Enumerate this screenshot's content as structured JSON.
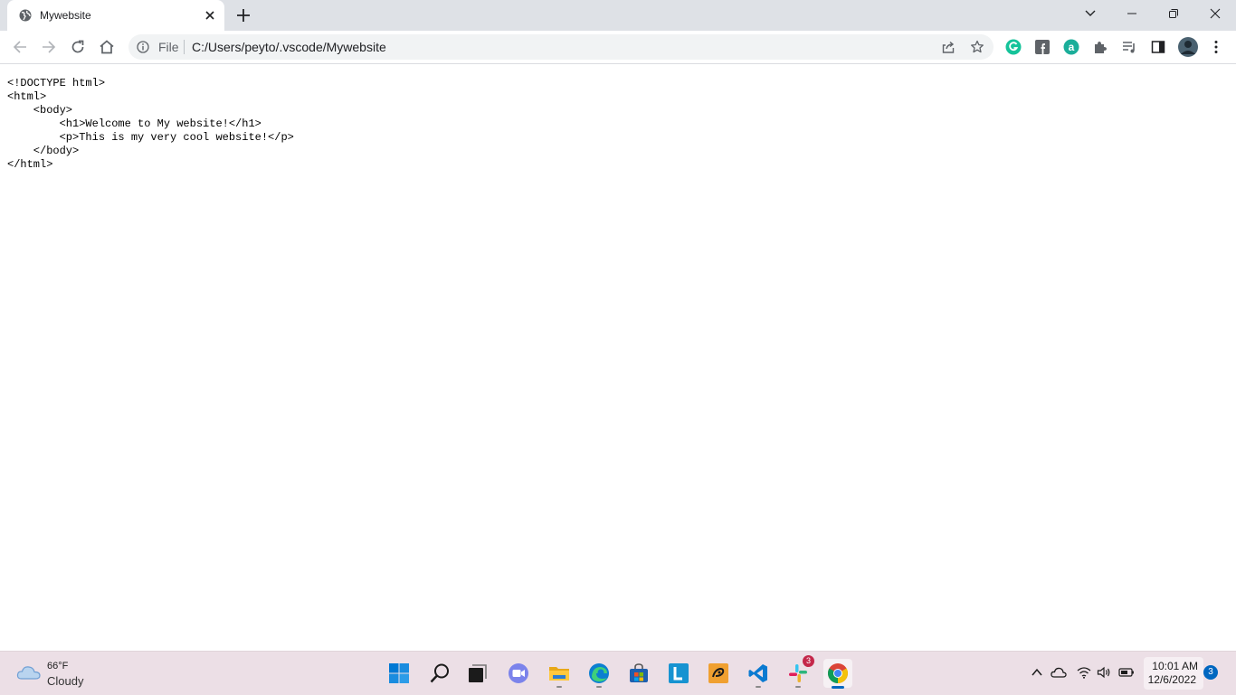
{
  "browser": {
    "tab": {
      "title": "Mywebsite"
    },
    "address": {
      "scheme": "File",
      "url": "C:/Users/peyto/.vscode/Mywebsite"
    }
  },
  "content": {
    "source_text": "<!DOCTYPE html>\n<html>\n    <body>\n        <h1>Welcome to My website!</h1>\n        <p>This is my very cool website!</p>\n    </body>\n</html>"
  },
  "taskbar": {
    "weather": {
      "temp": "66°F",
      "condition": "Cloudy"
    },
    "apps": [
      "windows-start",
      "search",
      "task-view",
      "teams-chat",
      "file-explorer",
      "edge",
      "microsoft-store",
      "l-app",
      "orange-app",
      "vscode",
      "slack",
      "chrome"
    ],
    "slack_badge": "3",
    "clock": {
      "time": "10:01 AM",
      "date": "12/6/2022"
    },
    "notification_count": "3"
  },
  "colors": {
    "accent": "#0067c0",
    "tabstrip": "#dee1e6",
    "taskbar": "#ecdfe6"
  }
}
